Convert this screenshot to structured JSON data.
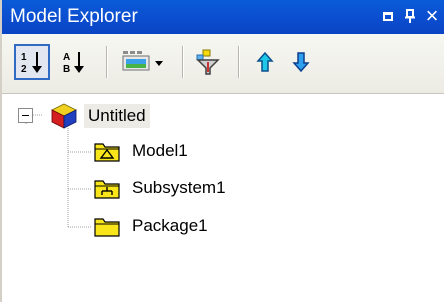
{
  "window": {
    "title": "Model Explorer",
    "controls": {
      "float_icon": "window-float-icon",
      "pin_icon": "pin-icon",
      "close_glyph": "×"
    }
  },
  "toolbar": {
    "buttons": [
      {
        "name": "sort-numeric-button",
        "icon": "sort-numeric-icon",
        "active": true
      },
      {
        "name": "sort-alpha-button",
        "icon": "sort-alpha-icon",
        "active": false
      },
      {
        "name": "view-dropdown-button",
        "icon": "view-options-icon",
        "active": false
      },
      {
        "name": "filter-button",
        "icon": "filter-icon",
        "active": false
      },
      {
        "name": "move-up-button",
        "icon": "arrow-up-icon",
        "active": false
      },
      {
        "name": "move-down-button",
        "icon": "arrow-down-icon",
        "active": false
      }
    ]
  },
  "tree": {
    "root": {
      "label": "Untitled",
      "expanded": true,
      "icon": "project-cube-icon",
      "children": [
        {
          "label": "Model1",
          "icon": "model-folder-icon"
        },
        {
          "label": "Subsystem1",
          "icon": "subsystem-folder-icon"
        },
        {
          "label": "Package1",
          "icon": "package-folder-icon"
        }
      ]
    }
  },
  "colors": {
    "titlebar": "#0b4fd0",
    "active_button_border": "#316ac5",
    "folder_yellow": "#f8e61a"
  }
}
